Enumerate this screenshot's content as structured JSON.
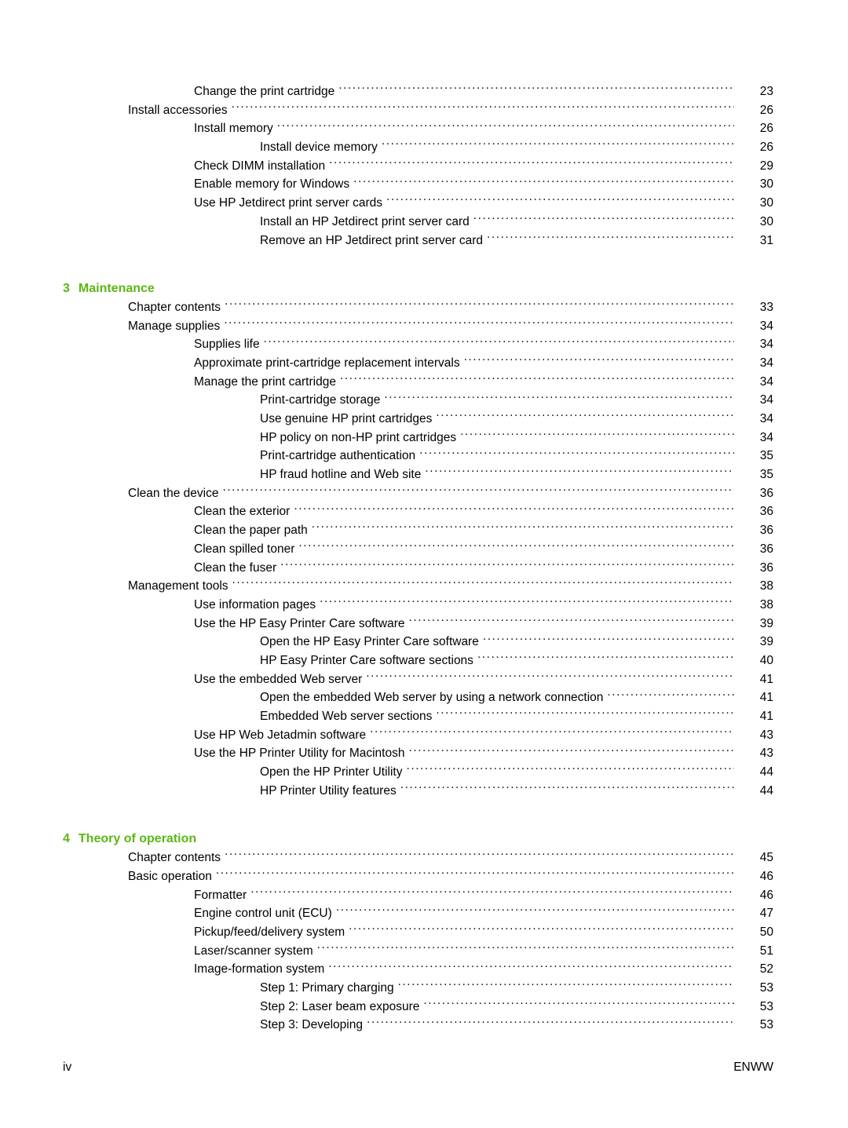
{
  "document": {
    "type": "table-of-contents",
    "footer": {
      "page_label": "iv",
      "locale_code": "ENWW"
    },
    "accent_color": "#5CB715"
  },
  "blocks": [
    {
      "kind": "entries",
      "entries": [
        {
          "level": 2,
          "label": "Change the print cartridge",
          "page": "23"
        },
        {
          "level": 1,
          "label": "Install accessories",
          "page": "26"
        },
        {
          "level": 2,
          "label": "Install memory",
          "page": "26"
        },
        {
          "level": 3,
          "label": "Install device memory",
          "page": "26"
        },
        {
          "level": 2,
          "label": "Check DIMM installation",
          "page": "29"
        },
        {
          "level": 2,
          "label": "Enable memory for Windows",
          "page": "30"
        },
        {
          "level": 2,
          "label": "Use HP Jetdirect print server cards",
          "page": "30"
        },
        {
          "level": 3,
          "label": "Install an HP Jetdirect print server card",
          "page": "30"
        },
        {
          "level": 3,
          "label": "Remove an HP Jetdirect print server card",
          "page": "31"
        }
      ]
    },
    {
      "kind": "chapter",
      "number": "3",
      "title": "Maintenance"
    },
    {
      "kind": "entries",
      "entries": [
        {
          "level": 1,
          "label": "Chapter contents",
          "page": "33"
        },
        {
          "level": 1,
          "label": "Manage supplies",
          "page": "34"
        },
        {
          "level": 2,
          "label": "Supplies life",
          "page": "34"
        },
        {
          "level": 2,
          "label": "Approximate print-cartridge replacement intervals",
          "page": "34"
        },
        {
          "level": 2,
          "label": "Manage the print cartridge",
          "page": "34"
        },
        {
          "level": 3,
          "label": "Print-cartridge storage",
          "page": "34"
        },
        {
          "level": 3,
          "label": "Use genuine HP print cartridges",
          "page": "34"
        },
        {
          "level": 3,
          "label": "HP policy on non-HP print cartridges",
          "page": "34"
        },
        {
          "level": 3,
          "label": "Print-cartridge authentication",
          "page": "35"
        },
        {
          "level": 3,
          "label": "HP fraud hotline and Web site",
          "page": "35"
        },
        {
          "level": 1,
          "label": "Clean the device",
          "page": "36"
        },
        {
          "level": 2,
          "label": "Clean the exterior",
          "page": "36"
        },
        {
          "level": 2,
          "label": "Clean the paper path",
          "page": "36"
        },
        {
          "level": 2,
          "label": "Clean spilled toner",
          "page": "36"
        },
        {
          "level": 2,
          "label": "Clean the fuser",
          "page": "36"
        },
        {
          "level": 1,
          "label": "Management tools",
          "page": "38"
        },
        {
          "level": 2,
          "label": "Use information pages",
          "page": "38"
        },
        {
          "level": 2,
          "label": "Use the HP Easy Printer Care software",
          "page": "39"
        },
        {
          "level": 3,
          "label": "Open the HP Easy Printer Care software",
          "page": "39"
        },
        {
          "level": 3,
          "label": "HP Easy Printer Care software sections",
          "page": "40"
        },
        {
          "level": 2,
          "label": "Use the embedded Web server",
          "page": "41"
        },
        {
          "level": 3,
          "label": "Open the embedded Web server by using a network connection",
          "page": "41"
        },
        {
          "level": 3,
          "label": "Embedded Web server sections",
          "page": "41"
        },
        {
          "level": 2,
          "label": "Use HP Web Jetadmin software",
          "page": "43"
        },
        {
          "level": 2,
          "label": "Use the HP Printer Utility for Macintosh",
          "page": "43"
        },
        {
          "level": 3,
          "label": "Open the HP Printer Utility",
          "page": "44"
        },
        {
          "level": 3,
          "label": "HP Printer Utility features",
          "page": "44"
        }
      ]
    },
    {
      "kind": "chapter",
      "number": "4",
      "title": "Theory of operation"
    },
    {
      "kind": "entries",
      "entries": [
        {
          "level": 1,
          "label": "Chapter contents",
          "page": "45"
        },
        {
          "level": 1,
          "label": "Basic operation",
          "page": "46"
        },
        {
          "level": 2,
          "label": "Formatter",
          "page": "46"
        },
        {
          "level": 2,
          "label": "Engine control unit (ECU)",
          "page": "47"
        },
        {
          "level": 2,
          "label": "Pickup/feed/delivery system",
          "page": "50"
        },
        {
          "level": 2,
          "label": "Laser/scanner system",
          "page": "51"
        },
        {
          "level": 2,
          "label": "Image-formation system",
          "page": "52"
        },
        {
          "level": 3,
          "label": "Step 1: Primary charging",
          "page": "53"
        },
        {
          "level": 3,
          "label": "Step 2: Laser beam exposure",
          "page": "53"
        },
        {
          "level": 3,
          "label": "Step 3: Developing",
          "page": "53"
        }
      ]
    }
  ]
}
